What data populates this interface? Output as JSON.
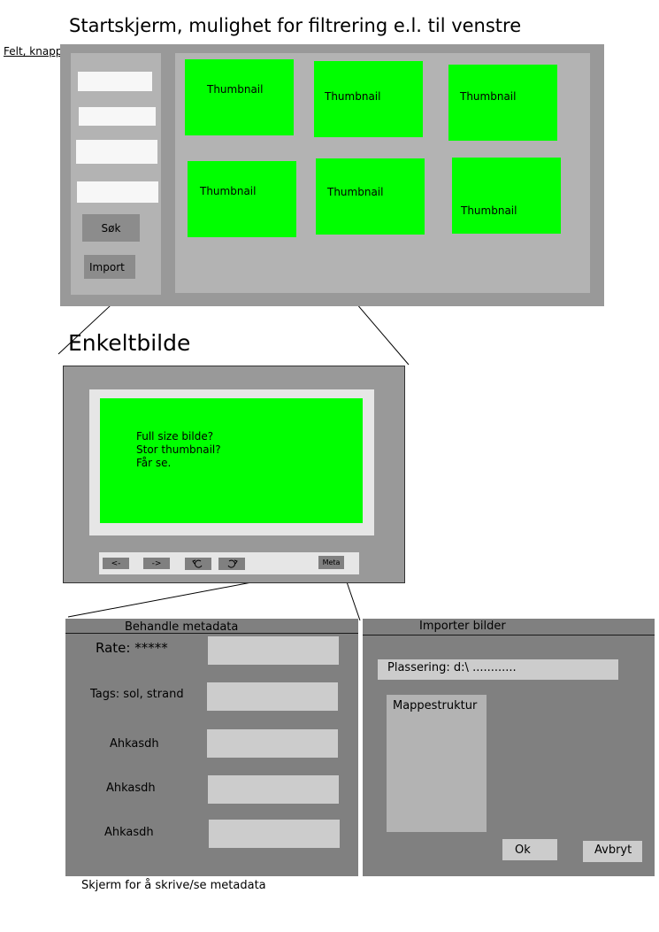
{
  "start_screen": {
    "title": "Startskjerm, mulighet for filtrering e.l. til venstre",
    "annotation": "Felt, knapper e.l. for filtrering av søk",
    "search_button": "Søk",
    "import_button": "Import",
    "thumbnails": [
      "Thumbnail",
      "Thumbnail",
      "Thumbnail",
      "Thumbnail",
      "Thumbnail",
      "Thumbnail"
    ]
  },
  "single_image": {
    "title": "Enkeltbilde",
    "image_text": [
      "Full size bilde?",
      "Stor thumbnail?",
      "Får se."
    ],
    "prev_button": "<-",
    "next_button": "->",
    "meta_button": "Meta"
  },
  "metadata_dialog": {
    "title": "Behandle metadata",
    "rate_label": "Rate: *****",
    "tags_label": "Tags: sol, strand",
    "field3_label": "Ahkasdh",
    "field4_label": "Ahkasdh",
    "field5_label": "Ahkasdh",
    "caption": "Skjerm for å skrive/se metadata"
  },
  "import_dialog": {
    "title": "Importer bilder",
    "location_label": "Plassering: d:\\ ............",
    "folder_tree_label": "Mappestruktur",
    "ok_button": "Ok",
    "cancel_button": "Avbryt"
  }
}
